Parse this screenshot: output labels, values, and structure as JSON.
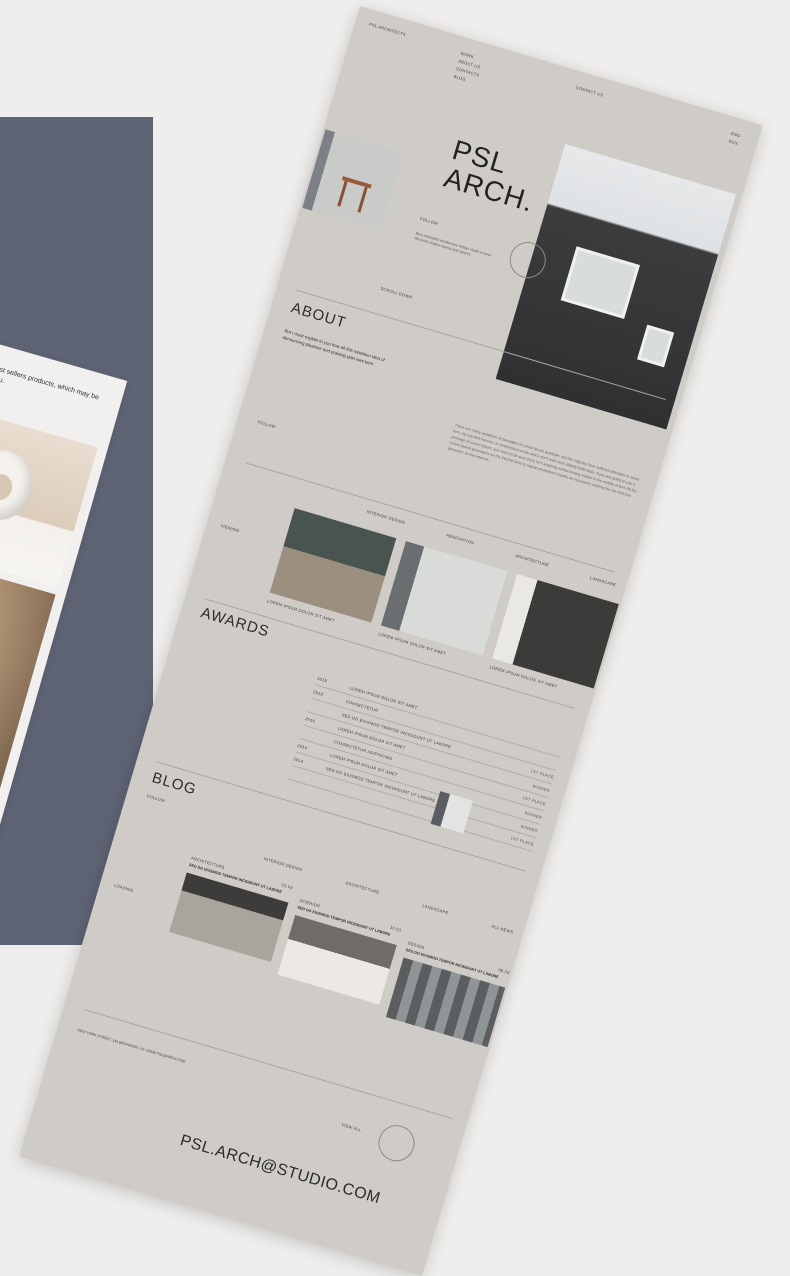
{
  "back_mockup": {
    "intro_text": "See our best sellers products, which may be intrest to you."
  },
  "site": {
    "brand": "PSL ARCHITECTS",
    "nav": [
      "WORK",
      "ABOUT US",
      "CONTACTS",
      "BLOG"
    ],
    "contact_link": "CONTACT US",
    "lang": [
      "ENG",
      "RUS"
    ]
  },
  "hero": {
    "title_line1": "PSL",
    "title_line2": "ARCH.",
    "follow": "FOLLOW",
    "description": "Best minimalist architecture design studio in town. We build modern homes and spaces.",
    "scroll": "SCROLL DOWN",
    "scroll_icon": "arrow-down-icon"
  },
  "about": {
    "title": "ABOUT",
    "lead": "But I must explain to you how all this mistaken idea of denouncing pleasure and praising pain was born",
    "body": "There are many variations of passages of Lorem Ipsum available, but the majority have suffered alteration in some form, by injected humour, or randomised words which don't look even slightly believable. If you are going to use a passage of Lorem Ipsum, you need to be sure there isn't anything embarrassing hidden in the middle of text. All the Lorem Ipsum generators on the Internet tend to repeat predefined chunks as necessary, making this the first true generator on the Internet.",
    "follow": "FOLLOW"
  },
  "projects": {
    "viewing": "VIEWING",
    "categories": [
      "INTERIOR DESIGN",
      "RENOVATION",
      "ARCHITECTURE",
      "LANDSCAPE"
    ],
    "items": [
      {
        "caption": "LOREM IPSUM DOLOR SIT AMET"
      },
      {
        "caption": "LOREM IPSUM DOLOR SIT AMET"
      },
      {
        "caption": "LOREM IPSUM DOLOR SIT AMET"
      }
    ]
  },
  "awards": {
    "title": "AWARDS",
    "rows": [
      {
        "year": "2019",
        "name": "LOREM IPSUM DOLOR SIT AMET",
        "place": ""
      },
      {
        "year": "2018",
        "name": "CONSECTETUR",
        "place": ""
      },
      {
        "year": "",
        "name": "SED DO EIUSMOD TEMPOR INCIDIDUNT UT LABORE",
        "place": "1ST PLACE"
      },
      {
        "year": "2016",
        "name": "LOREM IPSUM DOLOR SIT AMET",
        "place": "WINNER"
      },
      {
        "year": "",
        "name": "CONSECTETUR ADIPISCING",
        "place": "1ST PLACE"
      },
      {
        "year": "2015",
        "name": "LOREM IPSUM DOLOR SIT AMET",
        "place": "WINNER"
      },
      {
        "year": "2014",
        "name": "SED DO EIUSMOD TEMPOR INCIDIDUNT UT LABORE",
        "place": "WINNER"
      },
      {
        "year": "",
        "name": "",
        "place": "1ST PLACE"
      }
    ]
  },
  "blog": {
    "title": "BLOG",
    "follow": "FOLLOW",
    "loading": "LOADING",
    "categories": [
      "INTERIOR DESIGN",
      "ARCHITECTURE",
      "LANDSCAPE",
      "ALL NEWS"
    ],
    "posts": [
      {
        "tag": "ARCHITECTURE",
        "date": "12.03",
        "headline": "SED DO EIUSMOD TEMPOR INCIDIDUNT UT LABORE"
      },
      {
        "tag": "INTERIOR",
        "date": "10.03",
        "headline": "SED DO EIUSMOD TEMPOR INCIDIDUNT UT LABORE"
      },
      {
        "tag": "DESIGN",
        "date": "08.03",
        "headline": "SED DO EIUSMOD TEMPOR INCIDIDUNT UT LABORE"
      }
    ]
  },
  "footer": {
    "address": "NEW YORK STREET, 145 BROADWAY, NY 10006 PSL@ARCH.COM",
    "view_all": "VIEW ALL",
    "email": "PSL.ARCH@STUDIO.COM"
  }
}
